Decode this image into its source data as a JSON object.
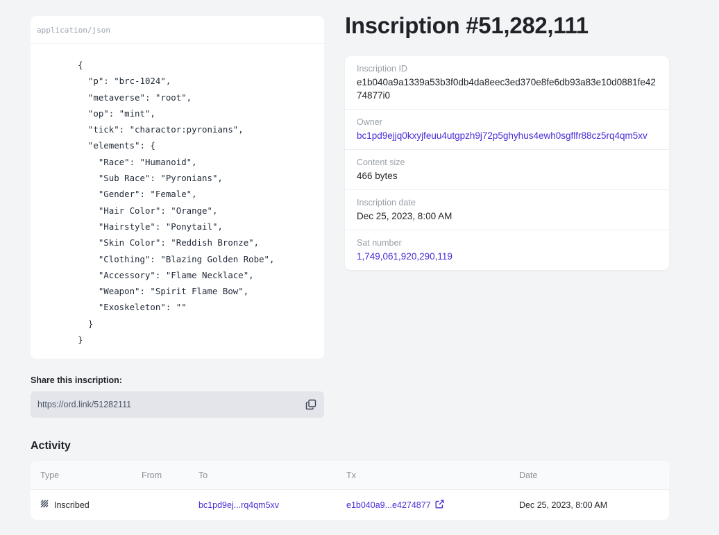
{
  "json_card": {
    "mime": "application/json",
    "content": "{\n  \"p\": \"brc-1024\",\n  \"metaverse\": \"root\",\n  \"op\": \"mint\",\n  \"tick\": \"charactor:pyronians\",\n  \"elements\": {\n    \"Race\": \"Humanoid\",\n    \"Sub Race\": \"Pyronians\",\n    \"Gender\": \"Female\",\n    \"Hair Color\": \"Orange\",\n    \"Hairstyle\": \"Ponytail\",\n    \"Skin Color\": \"Reddish Bronze\",\n    \"Clothing\": \"Blazing Golden Robe\",\n    \"Accessory\": \"Flame Necklace\",\n    \"Weapon\": \"Spirit Flame Bow\",\n    \"Exoskeleton\": \"\"\n  }\n}"
  },
  "title": "Inscription #51,282,111",
  "details": [
    {
      "label": "Inscription ID",
      "value": "e1b040a9a1339a53b3f0db4da8eec3ed370e8fe6db93a83e10d0881fe4274877i0"
    },
    {
      "label": "Owner",
      "value": "bc1pd9ejjq0kxyjfeuu4utgpzh9j72p5ghyhus4ewh0sgflfr88cz5rq4qm5xv"
    },
    {
      "label": "Content size",
      "value": "466 bytes"
    },
    {
      "label": "Inscription date",
      "value": "Dec 25, 2023, 8:00 AM"
    },
    {
      "label": "Sat number",
      "value": "1,749,061,920,290,119"
    }
  ],
  "share": {
    "label": "Share this inscription:",
    "url": "https://ord.link/51282111",
    "copy_icon": "copy-icon"
  },
  "activity": {
    "title": "Activity",
    "columns": [
      "Type",
      "From",
      "To",
      "Tx",
      "Date"
    ],
    "rows": [
      {
        "type": "Inscribed",
        "from": "",
        "to": "bc1pd9ej...rq4qm5xv",
        "tx": "e1b040a9...e4274877",
        "date": "Dec 25, 2023, 8:00 AM"
      }
    ]
  },
  "colors": {
    "background": "#f3f4f6",
    "link": "#4c2ad8",
    "card": "#ffffff"
  }
}
